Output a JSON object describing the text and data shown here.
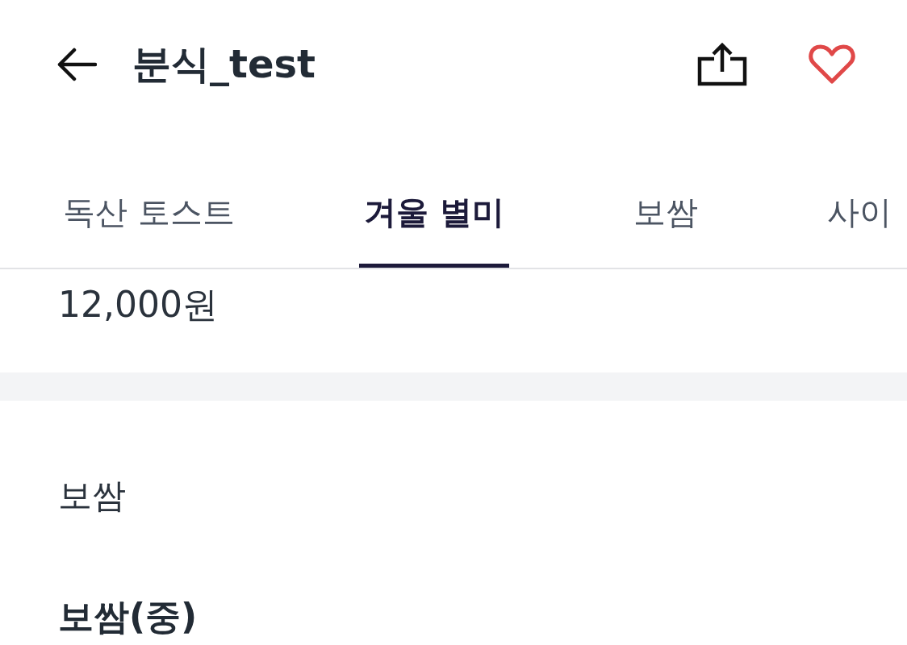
{
  "header": {
    "title": "분식_test"
  },
  "tabs": [
    {
      "label": "독산 토스트",
      "selected": false
    },
    {
      "label": "겨울 별미",
      "selected": true
    },
    {
      "label": "보쌈",
      "selected": false
    },
    {
      "label": "사이",
      "selected": false
    }
  ],
  "price": "12,000원",
  "menu_section": {
    "title": "보쌈",
    "items": [
      {
        "name": "보쌈(중)"
      }
    ]
  }
}
